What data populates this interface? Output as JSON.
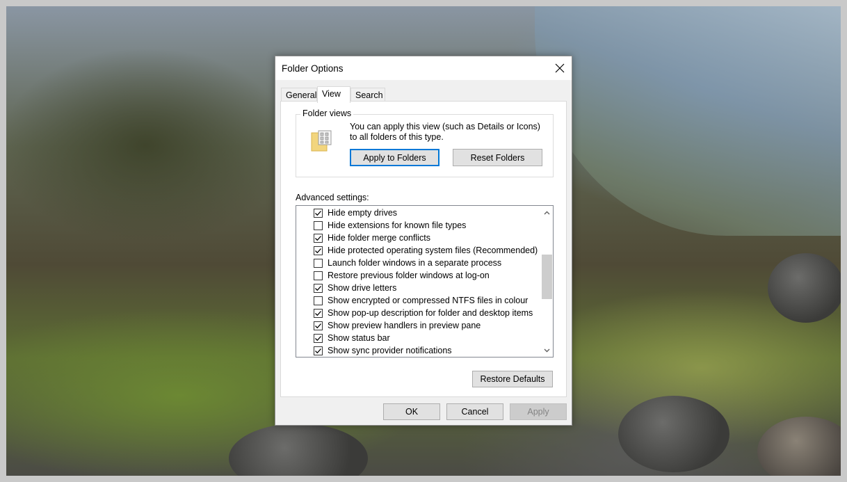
{
  "dialog": {
    "title": "Folder Options",
    "tabs": [
      {
        "label": "General",
        "active": false
      },
      {
        "label": "View",
        "active": true
      },
      {
        "label": "Search",
        "active": false
      }
    ],
    "folder_views": {
      "label": "Folder views",
      "description": "You can apply this view (such as Details or Icons) to all folders of this type.",
      "apply_button": "Apply to Folders",
      "reset_button": "Reset Folders"
    },
    "advanced": {
      "label": "Advanced settings:",
      "items": [
        {
          "label": "Hide empty drives",
          "checked": true
        },
        {
          "label": "Hide extensions for known file types",
          "checked": false
        },
        {
          "label": "Hide folder merge conflicts",
          "checked": true
        },
        {
          "label": "Hide protected operating system files (Recommended)",
          "checked": true
        },
        {
          "label": "Launch folder windows in a separate process",
          "checked": false
        },
        {
          "label": "Restore previous folder windows at log-on",
          "checked": false
        },
        {
          "label": "Show drive letters",
          "checked": true
        },
        {
          "label": "Show encrypted or compressed NTFS files in colour",
          "checked": false
        },
        {
          "label": "Show pop-up description for folder and desktop items",
          "checked": true
        },
        {
          "label": "Show preview handlers in preview pane",
          "checked": true
        },
        {
          "label": "Show status bar",
          "checked": true
        },
        {
          "label": "Show sync provider notifications",
          "checked": true
        }
      ],
      "restore_defaults_button": "Restore Defaults"
    },
    "footer": {
      "ok": "OK",
      "cancel": "Cancel",
      "apply": "Apply"
    }
  },
  "icons": {
    "close": "close-icon",
    "folder": "folder-view-icon",
    "scroll_up": "chevron-up-icon",
    "scroll_down": "chevron-down-icon",
    "check": "check-icon"
  },
  "colors": {
    "accent": "#0078d7",
    "dialog_bg": "#f0f0f0",
    "button_bg": "#e1e1e1"
  }
}
